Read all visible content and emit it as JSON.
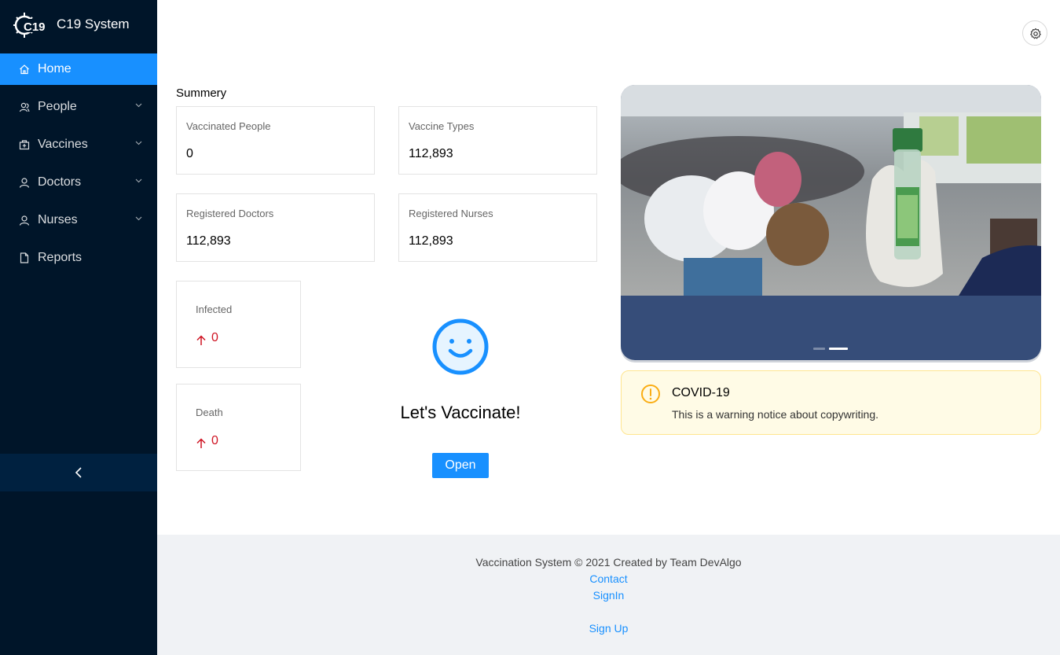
{
  "brand": {
    "title": "C19 System",
    "logo_text": "C19"
  },
  "sidebar": {
    "items": [
      {
        "label": "Home",
        "icon": "home-icon",
        "active": true
      },
      {
        "label": "People",
        "icon": "people-icon",
        "has_submenu": true
      },
      {
        "label": "Vaccines",
        "icon": "vaccine-box-icon",
        "has_submenu": true
      },
      {
        "label": "Doctors",
        "icon": "user-icon",
        "has_submenu": true
      },
      {
        "label": "Nurses",
        "icon": "user-icon",
        "has_submenu": true
      },
      {
        "label": "Reports",
        "icon": "file-icon"
      }
    ],
    "collapse_icon": "chevron-left-icon"
  },
  "header": {
    "settings_icon": "gear-icon"
  },
  "summary": {
    "title": "Summery",
    "cards": [
      {
        "label": "Vaccinated People",
        "value": "0"
      },
      {
        "label": "Vaccine Types",
        "value": "112,893"
      },
      {
        "label": "Registered Doctors",
        "value": "112,893"
      },
      {
        "label": "Registered Nurses",
        "value": "112,893"
      }
    ],
    "small_cards": [
      {
        "label": "Infected",
        "value": "0",
        "trend": "up"
      },
      {
        "label": "Death",
        "value": "0",
        "trend": "up"
      }
    ]
  },
  "promo": {
    "icon": "smile-icon",
    "text": "Let's Vaccinate!",
    "button_label": "Open"
  },
  "carousel": {
    "slide_count": 2,
    "active_slide": 2
  },
  "alert": {
    "icon": "exclamation-circle-icon",
    "title": "COVID-19",
    "description": "This is a warning notice about copywriting."
  },
  "footer": {
    "copyright": "Vaccination System © 2021 Created by Team DevAlgo",
    "links": [
      "Contact",
      "SignIn",
      "Sign Up"
    ]
  },
  "colors": {
    "sidebar_bg": "#001529",
    "accent": "#1890ff",
    "danger": "#cf1322",
    "warning_bg": "#fffbe6",
    "warning_border": "#ffe58f",
    "carousel_bg": "#364d79"
  }
}
